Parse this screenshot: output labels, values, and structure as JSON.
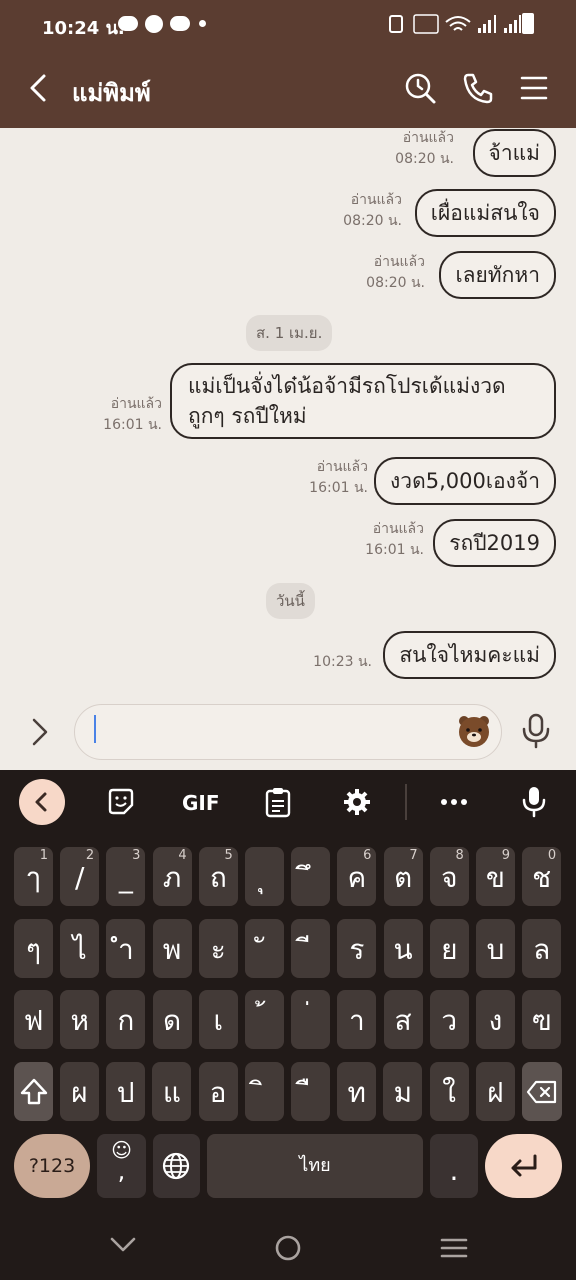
{
  "status_bar": {
    "time": "10:24 น."
  },
  "header": {
    "title": "แม่พิมพ์"
  },
  "chat": {
    "messages": [
      {
        "read": "อ่านแล้ว",
        "time": "08:20 น.",
        "text": "จ้าแม่"
      },
      {
        "read": "อ่านแล้ว",
        "time": "08:20 น.",
        "text": "เผื่อแม่สนใจ"
      },
      {
        "read": "อ่านแล้ว",
        "time": "08:20 น.",
        "text": "เลยทักหา"
      },
      {
        "read": "อ่านแล้ว",
        "time": "16:01 น.",
        "text": "แม่เป็นจั่งได๋น้อจ้ามีรถโปรเด้แม่งวดถูกๆ รถปีใหม่"
      },
      {
        "read": "อ่านแล้ว",
        "time": "16:01 น.",
        "text": "งวด5,000เองจ้า"
      },
      {
        "read": "อ่านแล้ว",
        "time": "16:01 น.",
        "text": "รถปี2019"
      },
      {
        "read": "",
        "time": "10:23 น.",
        "text": "สนใจไหมคะแม่"
      }
    ],
    "date_separators": [
      "ส. 1 เม.ย.",
      "วันนี้"
    ]
  },
  "input": {
    "placeholder": ""
  },
  "keyboard": {
    "toolbar": {
      "gif_label": "GIF"
    },
    "rows": [
      [
        {
          "k": "ๅ",
          "h": "1"
        },
        {
          "k": "/",
          "h": "2"
        },
        {
          "k": "_",
          "h": "3"
        },
        {
          "k": "ภ",
          "h": "4"
        },
        {
          "k": "ถ",
          "h": "5"
        },
        {
          "k": "ุ",
          "h": ""
        },
        {
          "k": "ึ",
          "h": ""
        },
        {
          "k": "ค",
          "h": "6"
        },
        {
          "k": "ต",
          "h": "7"
        },
        {
          "k": "จ",
          "h": "8"
        },
        {
          "k": "ข",
          "h": "9"
        },
        {
          "k": "ช",
          "h": "0"
        }
      ],
      [
        {
          "k": "ๆ",
          "h": ""
        },
        {
          "k": "ไ",
          "h": ""
        },
        {
          "k": "ำ",
          "h": ""
        },
        {
          "k": "พ",
          "h": ""
        },
        {
          "k": "ะ",
          "h": ""
        },
        {
          "k": "ั",
          "h": ""
        },
        {
          "k": "ี",
          "h": ""
        },
        {
          "k": "ร",
          "h": ""
        },
        {
          "k": "น",
          "h": ""
        },
        {
          "k": "ย",
          "h": ""
        },
        {
          "k": "บ",
          "h": ""
        },
        {
          "k": "ล",
          "h": ""
        }
      ],
      [
        {
          "k": "ฟ",
          "h": ""
        },
        {
          "k": "ห",
          "h": ""
        },
        {
          "k": "ก",
          "h": ""
        },
        {
          "k": "ด",
          "h": ""
        },
        {
          "k": "เ",
          "h": ""
        },
        {
          "k": "้",
          "h": ""
        },
        {
          "k": "่",
          "h": ""
        },
        {
          "k": "า",
          "h": ""
        },
        {
          "k": "ส",
          "h": ""
        },
        {
          "k": "ว",
          "h": ""
        },
        {
          "k": "ง",
          "h": ""
        },
        {
          "k": "ฃ",
          "h": ""
        }
      ],
      [
        {
          "k": "ผ",
          "h": ""
        },
        {
          "k": "ป",
          "h": ""
        },
        {
          "k": "แ",
          "h": ""
        },
        {
          "k": "อ",
          "h": ""
        },
        {
          "k": "ิ",
          "h": ""
        },
        {
          "k": "ื",
          "h": ""
        },
        {
          "k": "ท",
          "h": ""
        },
        {
          "k": "ม",
          "h": ""
        },
        {
          "k": "ใ",
          "h": ""
        },
        {
          "k": "ฝ",
          "h": ""
        }
      ]
    ],
    "symbols_label": "?123",
    "emoji_sub": ",",
    "space_label": "ไทย",
    "period_label": "."
  },
  "colors": {
    "header": "#5b3d31",
    "chat_bg": "#f0ece7",
    "keyboard_bg": "#211a18",
    "key": "#433a37",
    "accent_key": "#f7d8c8"
  }
}
